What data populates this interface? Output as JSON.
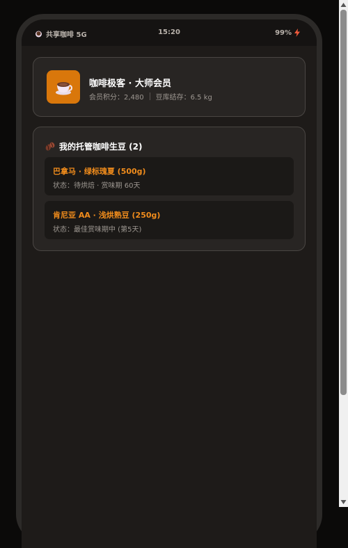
{
  "status_bar": {
    "app_label": "共享咖啡 5G",
    "time": "15:20",
    "battery": "99%"
  },
  "profile": {
    "name": "咖啡极客 · 大师会员",
    "points": "会员积分：2,480",
    "storage": "豆库结存：6.5 kg"
  },
  "beans_section": {
    "title": "我的托管咖啡生豆 (2)",
    "items": [
      {
        "name": "巴拿马 · 绿标瑰夏 (500g)",
        "status": "状态：待烘焙 · 赏味期 60天"
      },
      {
        "name": "肯尼亚 AA · 浅烘熟豆 (250g)",
        "status": "状态：最佳赏味期中 (第5天)"
      }
    ]
  },
  "colors": {
    "accent_orange": "#f08c1c",
    "avatar_bg": "#d9770b",
    "background": "#1e1b19"
  },
  "icons": {
    "status_app": "coffee-cup-icon",
    "battery": "charging-bolt-icon",
    "avatar": "coffee-cup-icon",
    "section": "coffee-beans-icon"
  }
}
